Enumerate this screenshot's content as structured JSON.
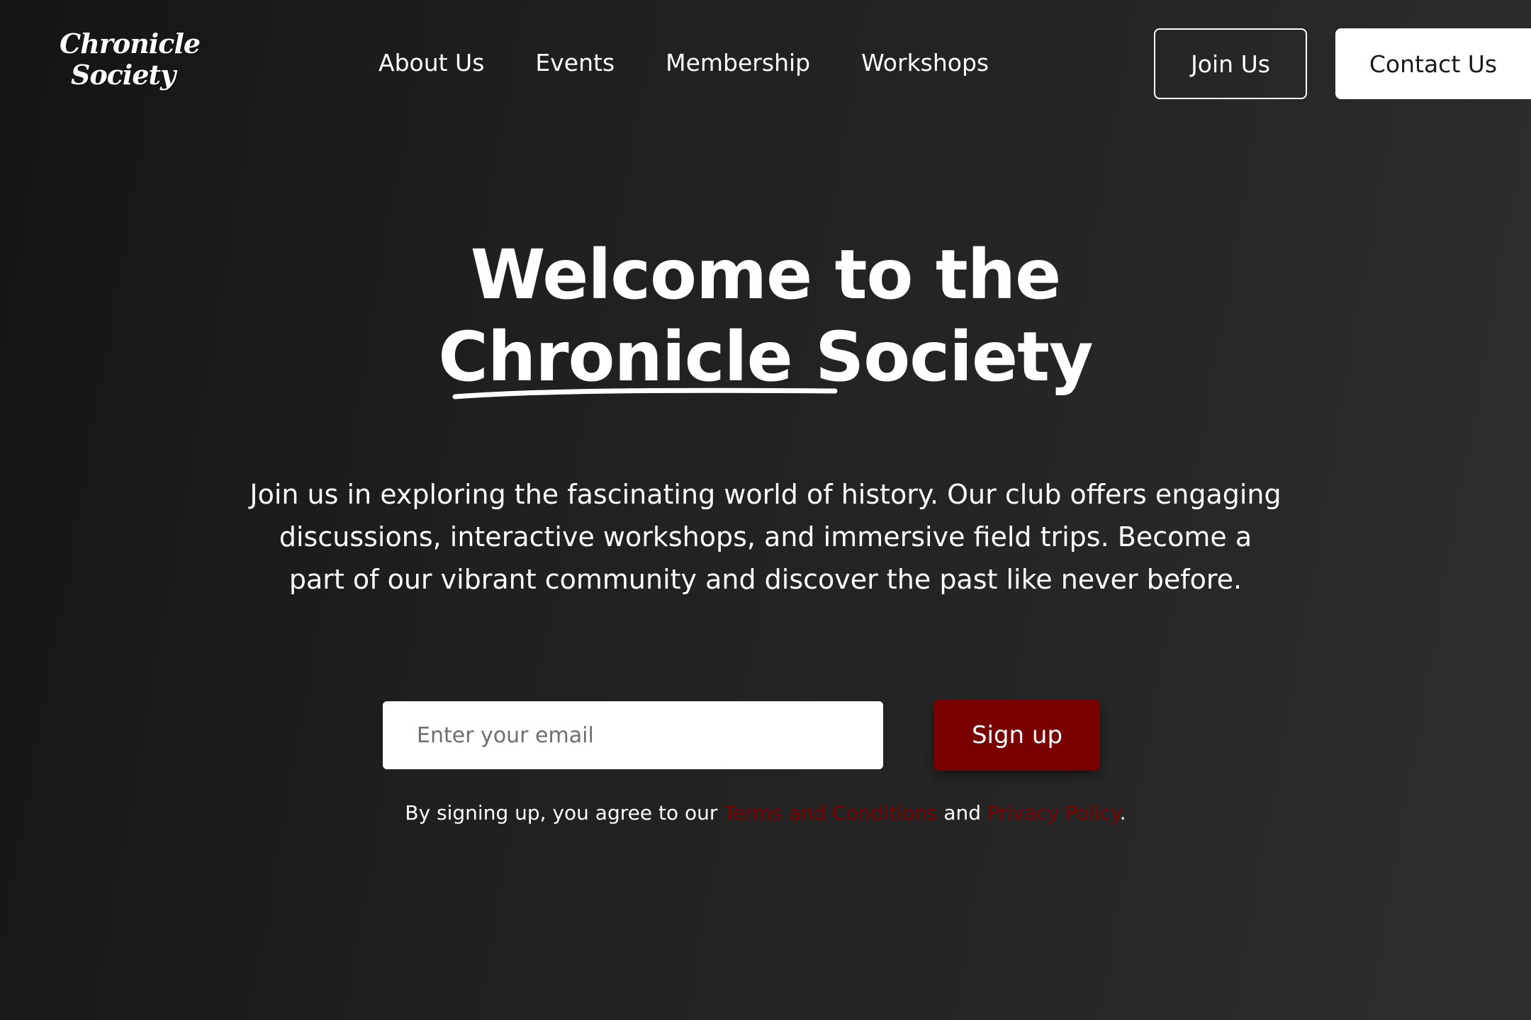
{
  "header": {
    "logo_line1": "Chronicle",
    "logo_line2": "Society",
    "nav": [
      "About Us",
      "Events",
      "Membership",
      "Workshops"
    ],
    "join_label": "Join Us",
    "contact_label": "Contact Us"
  },
  "hero": {
    "title_line1": "Welcome to the",
    "title_line2": "Chronicle Society",
    "description": "Join us in exploring the fascinating world of history. Our club offers engaging discussions, interactive workshops, and immersive field trips. Become a part of our vibrant community and discover the past like never before.",
    "email_placeholder": "Enter your email",
    "signup_label": "Sign up",
    "legal_prefix": "By signing up, you agree to our ",
    "terms_label": "Terms and Conditions",
    "legal_and": " and ",
    "privacy_label": "Privacy Policy",
    "legal_suffix": "."
  },
  "colors": {
    "accent": "#7a0000",
    "background_dark": "#141414",
    "background_light": "#2e2e2e",
    "text": "#ffffff"
  }
}
